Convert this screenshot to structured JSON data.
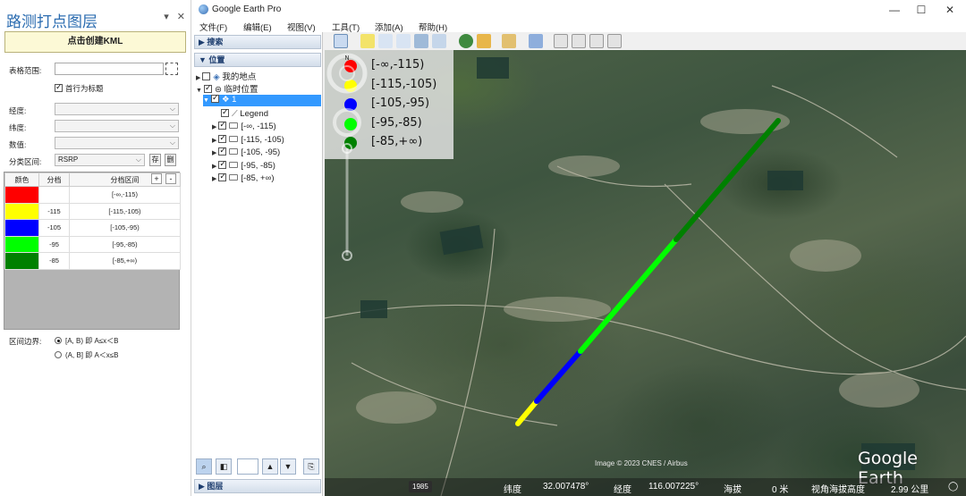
{
  "pane": {
    "title": "路测打点图层",
    "pin": "▾",
    "close": "✕",
    "create_button": "点击创建KML",
    "range_label": "表格范围:",
    "header_row_label": "首行为标题",
    "header_row_checked": true,
    "lon_label": "经度:",
    "lat_label": "纬度:",
    "value_label": "数值:",
    "class_label": "分类区间:",
    "class_value": "RSRP",
    "save_btn": "存",
    "delete_btn": "删",
    "table": {
      "headers": [
        "颜色",
        "分档",
        "分档区间"
      ],
      "add_btn": "+",
      "remove_btn": "-",
      "rows": [
        {
          "color": "#ff0000",
          "bin": "",
          "range": "[-∞,-115)"
        },
        {
          "color": "#ffff00",
          "bin": "-115",
          "range": "[-115,-105)"
        },
        {
          "color": "#0000ff",
          "bin": "-105",
          "range": "[-105,-95)"
        },
        {
          "color": "#00ff00",
          "bin": "-95",
          "range": "[-95,-85)"
        },
        {
          "color": "#008000",
          "bin": "-85",
          "range": "[-85,+∞)"
        }
      ]
    },
    "boundary_label": "区间边界:",
    "boundary_option1": "[A, B) 即 A≤x＜B",
    "boundary_option2": "(A, B] 即 A＜x≤B"
  },
  "ge": {
    "title": "Google Earth Pro",
    "window_controls": [
      "—",
      "☐",
      "✕"
    ],
    "menu": [
      "文件(F)",
      "编辑(E)",
      "视图(V)",
      "工具(T)",
      "添加(A)",
      "帮助(H)"
    ],
    "search_header": "▶ 搜索",
    "places_header": "▼ 位置",
    "layers_header": "▶ 图层",
    "tree": {
      "my_places": "我的地点",
      "temp_places": "临时位置",
      "item1": "1",
      "legend": "Legend",
      "folders": [
        "[-∞, -115)",
        "[-115, -105)",
        "[-105, -95)",
        "[-95, -85)",
        "[-85, +∞)"
      ]
    },
    "legend": [
      {
        "color": "#ff0000",
        "label": "[-∞,-115)"
      },
      {
        "color": "#ffff00",
        "label": "[-115,-105)"
      },
      {
        "color": "#0000ff",
        "label": "[-105,-95)"
      },
      {
        "color": "#00ff00",
        "label": "[-95,-85)"
      },
      {
        "color": "#008000",
        "label": "[-85,+∞)"
      }
    ],
    "attribution": "Image © 2023 CNES / Airbus",
    "brand": "Google Earth",
    "status": {
      "year": "1985",
      "lat_label": "纬度",
      "lat_value": "32.007478°",
      "lon_label": "经度",
      "lon_value": "116.007225°",
      "elev_label": "海拔",
      "elev_value": "0 米",
      "eye_label": "视角海拔高度",
      "eye_value": "2.99 公里",
      "compass": "◯"
    }
  }
}
